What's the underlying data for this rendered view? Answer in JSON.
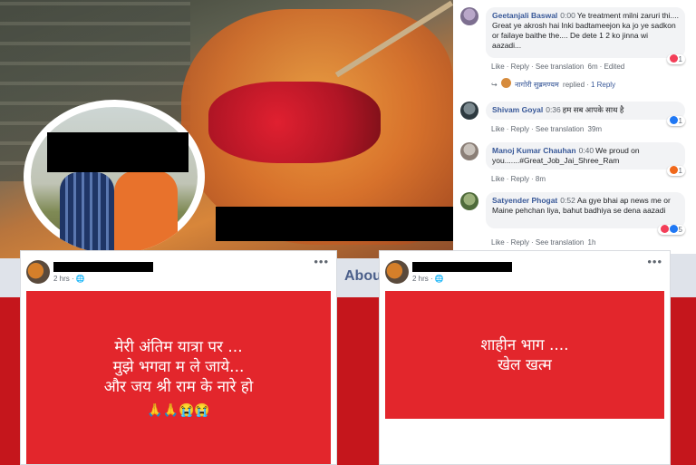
{
  "comments": [
    {
      "name": "Geetanjali Baswal",
      "time": "0:00",
      "text": "Ye treatment milni zaruri thi.... Great ye akrosh hai Inki badtameejon ka jo ye sadkon or failaye baithe the.... De dete 1 2 ko jinna wi aazadi...",
      "actions": [
        "Like",
        "Reply",
        "See translation",
        "6m",
        "Edited"
      ],
      "reaction_count": "1",
      "reply_name": "नागोरी सुब्रमण्यम",
      "reply_label": "replied",
      "reply_count": "1 Reply"
    },
    {
      "name": "Shivam Goyal",
      "time": "0:36",
      "text": "हम सब आपके साथ है",
      "actions": [
        "Like",
        "Reply",
        "See translation",
        "39m"
      ],
      "reaction_count": "1"
    },
    {
      "name": "Manoj Kumar Chauhan",
      "time": "0:40",
      "text": "We proud on you.......#Great_Job_Jai_Shree_Ram",
      "actions": [
        "Like",
        "Reply",
        "8m"
      ],
      "reaction_count": "1"
    },
    {
      "name": "Satyender Phogat",
      "time": "0:52",
      "text": "Aa gye bhai ap news me or Maine pehchan liya, bahut badhiya se dena aazadi",
      "actions": [
        "Like",
        "Reply",
        "See translation",
        "1h"
      ],
      "reaction_count": "5"
    }
  ],
  "about_label": "Abou",
  "posts": [
    {
      "time": "2 hrs · 🌐",
      "dots": "•••",
      "message": "मेरी अंतिम यात्रा पर ...\nमुझे भगवा म ले जाये...\nऔर जय श्री राम के नारे हो",
      "emoji": "🙏🙏😭😭"
    },
    {
      "time": "2 hrs · 🌐",
      "dots": "•••",
      "message": "शाहीन भाग ....\nखेल खत्म",
      "emoji": ""
    }
  ],
  "colors": {
    "fb_link": "#385898",
    "post_card": "#e3262c",
    "banner": "#c5161c"
  }
}
